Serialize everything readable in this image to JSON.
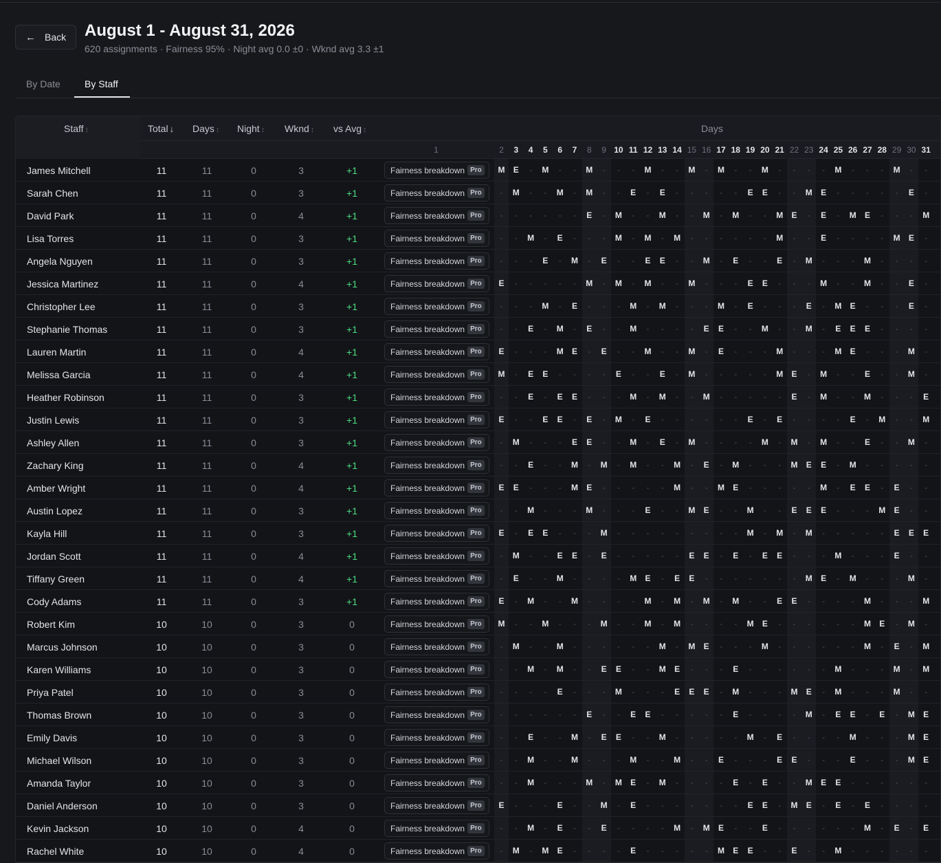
{
  "header": {
    "back_label": "Back",
    "title": "August 1 - August 31, 2026",
    "subtitle": "620 assignments · Fairness 95% · Night avg 0.0 ±0 · Wknd avg 3.3 ±1"
  },
  "tabs": [
    {
      "label": "By Date",
      "active": false
    },
    {
      "label": "By Staff",
      "active": true
    }
  ],
  "table": {
    "columns": {
      "staff": "Staff",
      "total": "Total",
      "days": "Days",
      "night": "Night",
      "wknd": "Wknd",
      "vs_avg": "vs Avg",
      "days_group": "Days"
    },
    "fairness_label": "Fairness breakdown",
    "pro_label": "Pro",
    "day_numbers": [
      "1",
      "2",
      "3",
      "4",
      "5",
      "6",
      "7",
      "8",
      "9",
      "10",
      "11",
      "12",
      "13",
      "14",
      "15",
      "16",
      "17",
      "18",
      "19",
      "20",
      "21",
      "22",
      "23",
      "24",
      "25",
      "26",
      "27",
      "28",
      "29",
      "30",
      "31"
    ],
    "weekend_days": [
      1,
      2,
      8,
      9,
      15,
      16,
      22,
      23,
      29,
      30
    ],
    "rows": [
      {
        "name": "James Mitchell",
        "total": "11",
        "days": "11",
        "night": "0",
        "wknd": "3",
        "vs": "+1",
        "shifts": "M E - M - - M - - - M - - M - M - - M - - - - M - - - M - - M"
      },
      {
        "name": "Sarah Chen",
        "total": "11",
        "days": "11",
        "night": "0",
        "wknd": "3",
        "vs": "+1",
        "shifts": "- M - - M - M - - E - E - - - - - E E - - M E - - - - - E - E -"
      },
      {
        "name": "David Park",
        "total": "11",
        "days": "11",
        "night": "0",
        "wknd": "4",
        "vs": "+1",
        "shifts": "- - - - - - E - M - - M - - M - M - - M E - E - M E - - - M -"
      },
      {
        "name": "Lisa Torres",
        "total": "11",
        "days": "11",
        "night": "0",
        "wknd": "3",
        "vs": "+1",
        "shifts": "- - M - E - - - M - M - M - - - - - - M - - E - - - - M E - E E"
      },
      {
        "name": "Angela Nguyen",
        "total": "11",
        "days": "11",
        "night": "0",
        "wknd": "3",
        "vs": "+1",
        "shifts": "- - - E - M - E - - E E - - M - E - - E - M - - - M - - - - E"
      },
      {
        "name": "Jessica Martinez",
        "total": "11",
        "days": "11",
        "night": "0",
        "wknd": "4",
        "vs": "+1",
        "shifts": "E - - - - - M - M - M - - M - - - E E - - - M - - M - - E - M"
      },
      {
        "name": "Christopher Lee",
        "total": "11",
        "days": "11",
        "night": "0",
        "wknd": "3",
        "vs": "+1",
        "shifts": "- - - M - E - - - M - M - - - M - E - - - E - M E - - - E - M"
      },
      {
        "name": "Stephanie Thomas",
        "total": "11",
        "days": "11",
        "night": "0",
        "wknd": "3",
        "vs": "+1",
        "shifts": "- - E - M - E - - M - - - - E E - - M - - M - E E E - - - - -"
      },
      {
        "name": "Lauren Martin",
        "total": "11",
        "days": "11",
        "night": "0",
        "wknd": "4",
        "vs": "+1",
        "shifts": "E - - - M E - E - - M - - M - E - - - M - - - M E - - - M - -"
      },
      {
        "name": "Melissa Garcia",
        "total": "11",
        "days": "11",
        "night": "0",
        "wknd": "4",
        "vs": "+1",
        "shifts": "M - E E - - - - E - - E - M - - - - - M E - M - - E - - M - -"
      },
      {
        "name": "Heather Robinson",
        "total": "11",
        "days": "11",
        "night": "0",
        "wknd": "3",
        "vs": "+1",
        "shifts": "- - E - E E - - - M - M - - M - - - - - E - M - - M - - - E E"
      },
      {
        "name": "Justin Lewis",
        "total": "11",
        "days": "11",
        "night": "0",
        "wknd": "3",
        "vs": "+1",
        "shifts": "E - - E E - E - M - E - - - - - - E - E - - - - E - M - - M -"
      },
      {
        "name": "Ashley Allen",
        "total": "11",
        "days": "11",
        "night": "0",
        "wknd": "3",
        "vs": "+1",
        "shifts": "- M - - - E E - - M - E - M - - - - M - M - M - - E - - M - -"
      },
      {
        "name": "Zachary King",
        "total": "11",
        "days": "11",
        "night": "0",
        "wknd": "4",
        "vs": "+1",
        "shifts": "- - E - - M - M - M - - M - E - M - - - M E E - M - - - - - -"
      },
      {
        "name": "Amber Wright",
        "total": "11",
        "days": "11",
        "night": "0",
        "wknd": "4",
        "vs": "+1",
        "shifts": "E E - - - M E - - - - - M - - M E - - - - - M - E E - E - - -"
      },
      {
        "name": "Austin Lopez",
        "total": "11",
        "days": "11",
        "night": "0",
        "wknd": "3",
        "vs": "+1",
        "shifts": "- - M - - - M - - - E - - M E - - M - - E E E - - - M E - - -"
      },
      {
        "name": "Kayla Hill",
        "total": "11",
        "days": "11",
        "night": "0",
        "wknd": "3",
        "vs": "+1",
        "shifts": "E - E E - - - M - - - - - - - - - M - M - M - - - - - E E E - M"
      },
      {
        "name": "Jordan Scott",
        "total": "11",
        "days": "11",
        "night": "0",
        "wknd": "4",
        "vs": "+1",
        "shifts": "- M - - E E - E - - - - - E E - E - E E - - - M - - - E - - -"
      },
      {
        "name": "Tiffany Green",
        "total": "11",
        "days": "11",
        "night": "0",
        "wknd": "4",
        "vs": "+1",
        "shifts": "- E - - M - - - - M E - E E - - - - - - - M E - M - - - M - E"
      },
      {
        "name": "Cody Adams",
        "total": "11",
        "days": "11",
        "night": "0",
        "wknd": "3",
        "vs": "+1",
        "shifts": "E - M - - M - - - - M - M - M - M - - E E - - - - M - - - M -"
      },
      {
        "name": "Robert Kim",
        "total": "10",
        "days": "10",
        "night": "0",
        "wknd": "3",
        "vs": "0",
        "shifts": "M - - M - - - M - - M - M - - - - M E - - - - - - M E - M - -"
      },
      {
        "name": "Marcus Johnson",
        "total": "10",
        "days": "10",
        "night": "0",
        "wknd": "3",
        "vs": "0",
        "shifts": "- M - - M - - - - - - M - M E - - - M - - - - - - M - E - M E"
      },
      {
        "name": "Karen Williams",
        "total": "10",
        "days": "10",
        "night": "0",
        "wknd": "3",
        "vs": "0",
        "shifts": "- - M - M - - E E - - M E - - - E - - - - - - M - - - M - M -"
      },
      {
        "name": "Priya Patel",
        "total": "10",
        "days": "10",
        "night": "0",
        "wknd": "3",
        "vs": "0",
        "shifts": "- - - - E - - - M - - - E E E - M - - - M E - M - - - M - - -"
      },
      {
        "name": "Thomas Brown",
        "total": "10",
        "days": "10",
        "night": "0",
        "wknd": "3",
        "vs": "0",
        "shifts": "- - - - - - E - - E E - - - - - E - - - - M - E E - E - M E -"
      },
      {
        "name": "Emily Davis",
        "total": "10",
        "days": "10",
        "night": "0",
        "wknd": "3",
        "vs": "0",
        "shifts": "- - E - - M - E E - - M - - - - - M - E - - - - M - - - M E -"
      },
      {
        "name": "Michael Wilson",
        "total": "10",
        "days": "10",
        "night": "0",
        "wknd": "3",
        "vs": "0",
        "shifts": "- - M - - M - - - M - - M - - E - - - E E - - - E - - - M E -"
      },
      {
        "name": "Amanda Taylor",
        "total": "10",
        "days": "10",
        "night": "0",
        "wknd": "3",
        "vs": "0",
        "shifts": "- - M - - - M - M E - M - - - - E - E - - M E E - - - - - - -"
      },
      {
        "name": "Daniel Anderson",
        "total": "10",
        "days": "10",
        "night": "0",
        "wknd": "3",
        "vs": "0",
        "shifts": "E - - - E - - M - E - - - - - - - E E - M E - E - E - - - - -"
      },
      {
        "name": "Kevin Jackson",
        "total": "10",
        "days": "10",
        "night": "0",
        "wknd": "4",
        "vs": "0",
        "shifts": "- - M - E - - E - - - - M - M E - - E - - - - - - M - E - E -"
      },
      {
        "name": "Rachel White",
        "total": "10",
        "days": "10",
        "night": "0",
        "wknd": "4",
        "vs": "0",
        "shifts": "- M - M E - - - - E - - - - - M E E - - E - - M - - - - - - M"
      }
    ]
  }
}
